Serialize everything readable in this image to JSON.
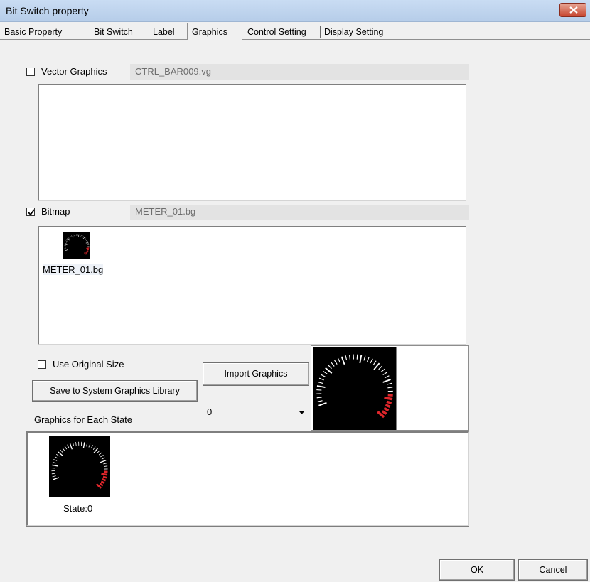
{
  "window": {
    "title": "Bit Switch property"
  },
  "tabs": [
    {
      "label": "Basic Property",
      "active": false
    },
    {
      "label": "Bit Switch",
      "active": false
    },
    {
      "label": "Label",
      "active": false
    },
    {
      "label": "Graphics",
      "active": true
    },
    {
      "label": "Control Setting",
      "active": false
    },
    {
      "label": "Display Setting",
      "active": false
    }
  ],
  "vector_graphics": {
    "label": "Vector Graphics",
    "checked": false,
    "filename": "CTRL_BAR009.vg"
  },
  "bitmap": {
    "label": "Bitmap",
    "checked": true,
    "filename": "METER_01.bg",
    "thumbnail_label": "METER_01.bg"
  },
  "options": {
    "use_original_size_label": "Use Original Size",
    "use_original_size_checked": false,
    "save_library_label": "Save to System Graphics Library",
    "import_graphics_label": "Import Graphics",
    "state_select_value": "0",
    "graphics_each_state_label": "Graphics for Each State"
  },
  "states": [
    {
      "label": "State:0"
    }
  ],
  "footer": {
    "ok_label": "OK",
    "cancel_label": "Cancel"
  },
  "colors": {
    "titlebar": "#c9dcf3",
    "close_button": "#c7452f",
    "gauge_accent": "#e0262b",
    "gauge_bg": "#000000"
  },
  "icons": {
    "close": "close-icon",
    "gauge": "meter-gauge-icon",
    "dropdown": "chevron-down-icon"
  }
}
